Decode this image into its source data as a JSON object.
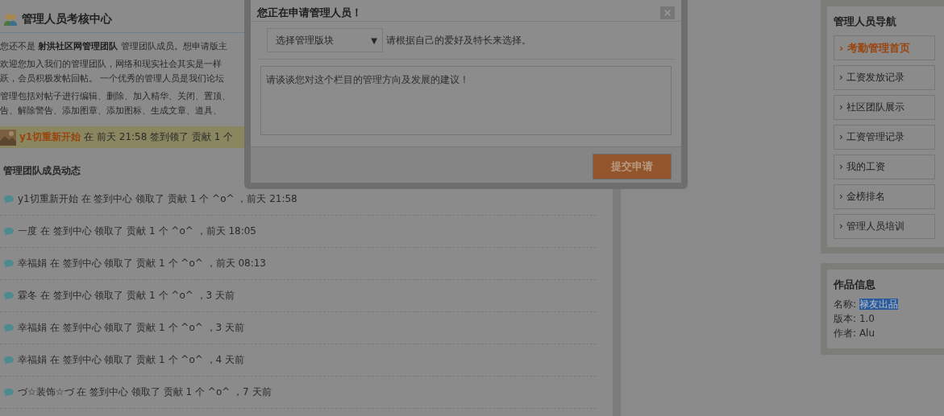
{
  "main": {
    "title": "管理人员考核中心",
    "intro": [
      "您还不是 **射洪社区网管理团队** 管理团队成员。想申请版主",
      "欢迎您加入我们的管理团队，网络和现实社会其实是一样",
      "跃，会员积极发帖回帖。 一个优秀的管理人员是我们论坛",
      "管理包括对帖子进行编辑、删除、加入精华、关闭、置顶、",
      "告、解除警告、添加图章、添加图标、生成文章、道具、"
    ],
    "latest_signin": {
      "user": "y1切重新开始",
      "text": "在 前天 21:58 签到领了 贡献 1 个"
    },
    "activity_title": "管理团队成员动态",
    "activity": [
      "y1切重新开始 在 签到中心 领取了 贡献 1 个 ^o^ ，前天 21:58",
      "一度 在 签到中心 领取了 贡献 1 个 ^o^ ，前天 18:05",
      "幸福娟 在 签到中心 领取了 贡献 1 个 ^o^ ，前天 08:13",
      "霖冬 在 签到中心 领取了 贡献 1 个 ^o^ ，3 天前",
      "幸福娟 在 签到中心 领取了 贡献 1 个 ^o^ ，3 天前",
      "幸福娟 在 签到中心 领取了 贡献 1 个 ^o^ ，4 天前",
      "づ☆装饰☆づ 在 签到中心 领取了 贡献 1 个 ^o^ ，7 天前"
    ]
  },
  "dialog": {
    "title": "您正在申请管理人员！",
    "select": {
      "value": "选择管理版块",
      "caret": "▼"
    },
    "select_hint": "请根据自己的爱好及特长来选择。",
    "textarea": {
      "placeholder": "请谈谈您对这个栏目的管理方向及发展的建议！"
    },
    "submit": "提交申请"
  },
  "sidebar": {
    "nav_title": "管理人员导航",
    "bullet": "›",
    "nav": [
      {
        "label": "考勤管理首页",
        "selected": true
      },
      {
        "label": "工资发放记录",
        "selected": false
      },
      {
        "label": "社区团队展示",
        "selected": false
      },
      {
        "label": "工资管理记录",
        "selected": false
      },
      {
        "label": "我的工资",
        "selected": false
      },
      {
        "label": "金榜排名",
        "selected": false
      },
      {
        "label": "管理人员培训",
        "selected": false
      }
    ],
    "info_title": "作品信息",
    "info": [
      {
        "label": "名称:",
        "value": "禄友出品",
        "highlighted": true
      },
      {
        "label": "版本:",
        "value": "1.0",
        "highlighted": false
      },
      {
        "label": "作者:",
        "value": "Alu",
        "highlighted": false
      }
    ]
  }
}
